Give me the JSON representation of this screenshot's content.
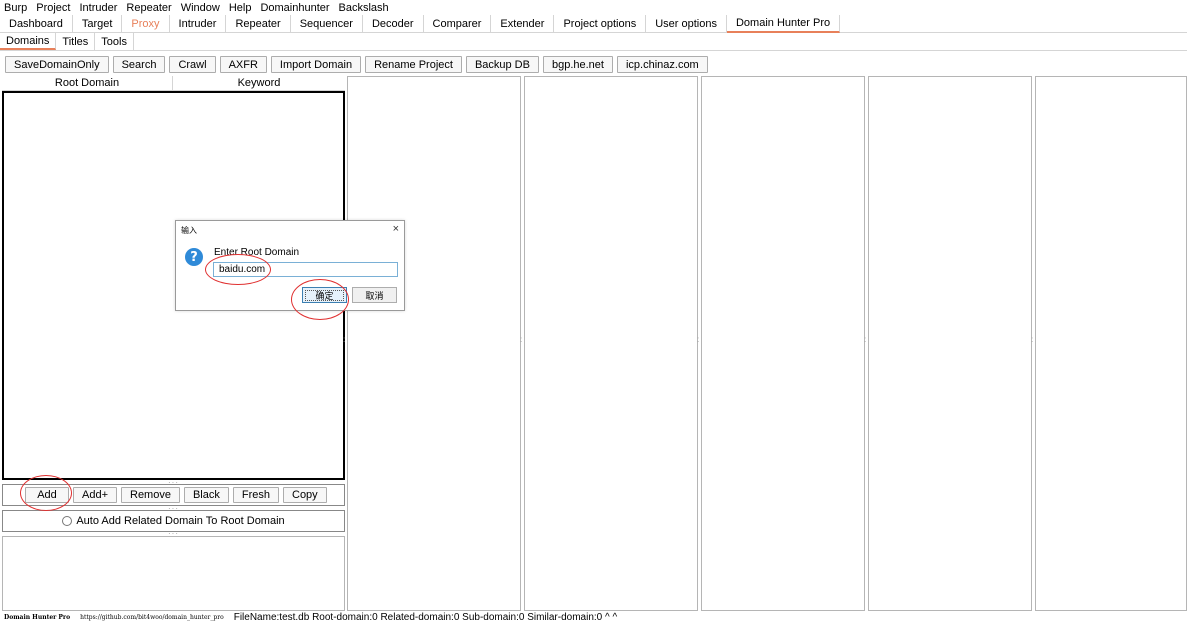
{
  "menu": [
    "Burp",
    "Project",
    "Intruder",
    "Repeater",
    "Window",
    "Help",
    "Domainhunter",
    "Backslash"
  ],
  "tabs": [
    "Dashboard",
    "Target",
    "Proxy",
    "Intruder",
    "Repeater",
    "Sequencer",
    "Decoder",
    "Comparer",
    "Extender",
    "Project options",
    "User options",
    "Domain Hunter Pro"
  ],
  "subtabs": [
    "Domains",
    "Titles",
    "Tools"
  ],
  "toolbar": [
    "SaveDomainOnly",
    "Search",
    "Crawl",
    "AXFR",
    "Import Domain",
    "Rename Project",
    "Backup DB",
    "bgp.he.net",
    "icp.chinaz.com"
  ],
  "table": {
    "headers": [
      "Root Domain",
      "Keyword"
    ]
  },
  "buttons": [
    "Add",
    "Add+",
    "Remove",
    "Black",
    "Fresh",
    "Copy"
  ],
  "auto_add_label": "Auto Add Related Domain To Root Domain",
  "dialog": {
    "title": "输入",
    "close": "×",
    "icon": "?",
    "label": "Enter Root Domain",
    "input_value": "baidu.com",
    "ok": "确定",
    "cancel": "取消"
  },
  "status": {
    "brand": "Domain Hunter Pro",
    "url": "https://github.com/bit4woo/domain_hunter_pro",
    "text": "FileName:test.db  Root-domain:0  Related-domain:0  Sub-domain:0  Similar-domain:0  ^  ^"
  },
  "colors": {
    "accent": "#e8805a",
    "annotation": "#e03030",
    "dialog_icon": "#2f8ad8"
  },
  "icons": {
    "dialog_icon": "question-icon",
    "close": "close-icon"
  }
}
